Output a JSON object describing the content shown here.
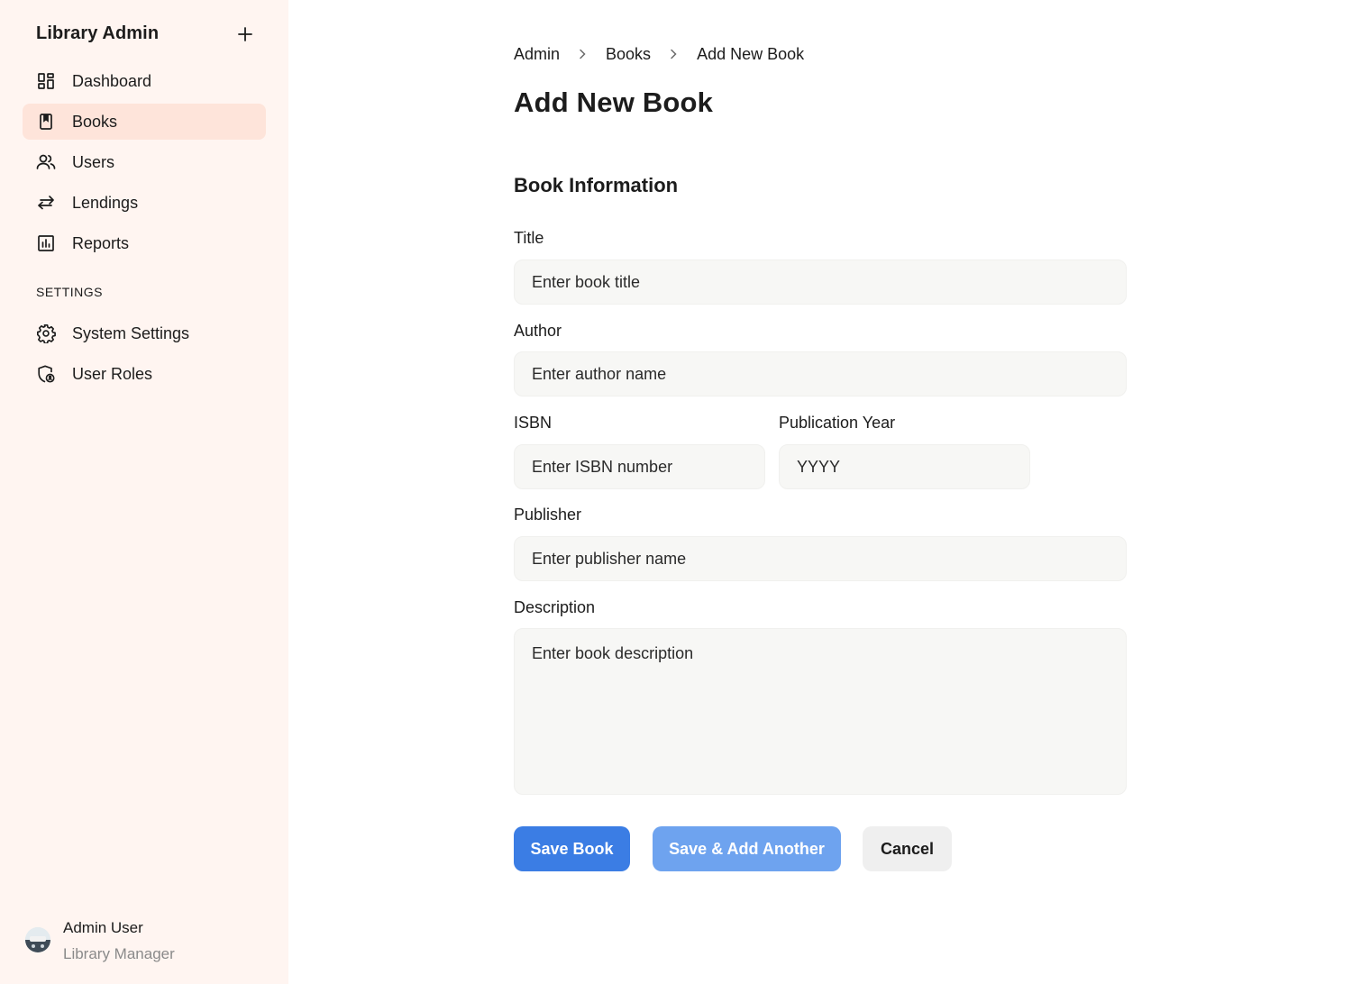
{
  "sidebar": {
    "title": "Library Admin",
    "add_icon": "plus-icon",
    "items": [
      {
        "label": "Dashboard",
        "icon": "dashboard-icon",
        "active": false
      },
      {
        "label": "Books",
        "icon": "book-icon",
        "active": true
      },
      {
        "label": "Users",
        "icon": "users-icon",
        "active": false
      },
      {
        "label": "Lendings",
        "icon": "swap-arrows-icon",
        "active": false
      },
      {
        "label": "Reports",
        "icon": "chart-icon",
        "active": false
      }
    ],
    "settings_label": "SETTINGS",
    "settings_items": [
      {
        "label": "System Settings",
        "icon": "gear-icon"
      },
      {
        "label": "User Roles",
        "icon": "shield-user-icon"
      }
    ],
    "user": {
      "name": "Admin User",
      "role": "Library Manager"
    }
  },
  "breadcrumb": [
    "Admin",
    "Books",
    "Add New Book"
  ],
  "page_title": "Add New Book",
  "form": {
    "section_title": "Book Information",
    "title": {
      "label": "Title",
      "placeholder": "Enter book title",
      "value": ""
    },
    "author": {
      "label": "Author",
      "placeholder": "Enter author name",
      "value": ""
    },
    "isbn": {
      "label": "ISBN",
      "placeholder": "Enter ISBN number",
      "value": ""
    },
    "year": {
      "label": "Publication Year",
      "placeholder": "YYYY",
      "value": ""
    },
    "publisher": {
      "label": "Publisher",
      "placeholder": "Enter publisher name",
      "value": ""
    },
    "description": {
      "label": "Description",
      "placeholder": "Enter book description",
      "value": ""
    }
  },
  "actions": {
    "save": "Save Book",
    "save_add": "Save & Add Another",
    "cancel": "Cancel"
  },
  "colors": {
    "sidebar_bg": "#fff5f1",
    "active_item_bg": "#fee4da",
    "primary": "#3b7de4",
    "primary_light": "#6ea3ef",
    "input_bg": "#f7f7f5"
  }
}
